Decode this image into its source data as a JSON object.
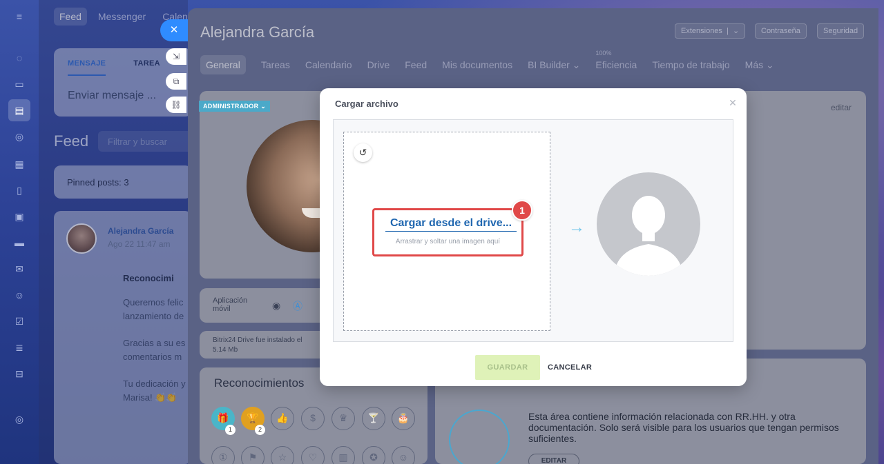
{
  "feed": {
    "tabs": [
      "Feed",
      "Messenger",
      "Calen"
    ],
    "composer_tabs": [
      "MENSAJE",
      "TAREA"
    ],
    "composer_placeholder": "Enviar mensaje ...",
    "title": "Feed",
    "search_placeholder": "Filtrar y buscar",
    "pinned": "Pinned posts: 3",
    "post": {
      "author": "Alejandra García",
      "time": "Ago 22 11:47 am",
      "title": "Reconocimi",
      "lines": [
        "Queremos felic",
        "lanzamiento de",
        "Gracias a su es",
        "comentarios m",
        "Tu dedicación y",
        "Marisa! 👏👏"
      ]
    }
  },
  "profile": {
    "name": "Alejandra García",
    "header_buttons": [
      "Extensiones",
      "Contraseña",
      "Seguridad"
    ],
    "tabs": [
      "General",
      "Tareas",
      "Calendario",
      "Drive",
      "Feed",
      "Mis documentos",
      "BI Builder",
      "Eficiencia",
      "Tiempo de trabajo",
      "Más"
    ],
    "efficiency_pct": "100%",
    "admin_badge": "ADMINISTRADOR",
    "mobile_app_label": "Aplicación móvil",
    "drive_info_line1": "Bitrix24 Drive fue instalado el",
    "drive_info_line2": "5.14 Mb",
    "recognitions_title": "Reconocimientos",
    "badge_counts": [
      "1",
      "2"
    ],
    "edit_link": "editar",
    "hr_text": "Esta área contiene información relacionada con RR.HH. y otra documentación. Solo será visible para los usuarios que tengan permisos suficientes.",
    "hr_edit_button": "EDITAR"
  },
  "modal": {
    "title": "Cargar archivo",
    "upload_link": "Cargar desde el drive...",
    "drop_hint": "Arrastrar y soltar una imagen aquí",
    "step_number": "1",
    "save_label": "GUARDAR",
    "cancel_label": "CANCELAR"
  },
  "colors": {
    "accent_blue": "#2067b0",
    "highlight_red": "#e04848",
    "save_disabled_bg": "#dff2b8",
    "arrow": "#6fc5ea"
  }
}
